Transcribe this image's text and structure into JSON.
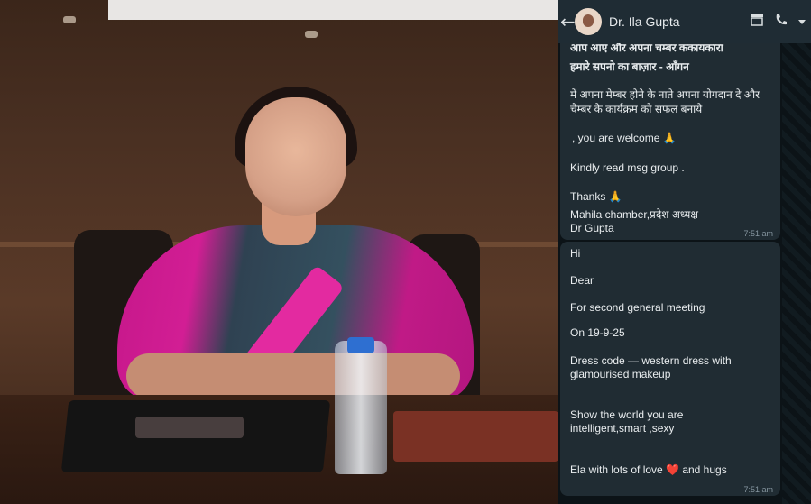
{
  "chat": {
    "contact_name": "Dr. Ila Gupta",
    "back_glyph": "←",
    "icons": [
      "store-icon",
      "call-icon",
      "dropdown-icon"
    ],
    "messages": [
      {
        "lines": [
          "आप आए और अपना चम्बर ककायकारा",
          "हमारे सपनो का बाज़ार - आँगन",
          "में अपना मेम्बर होने के नाते अपना योगदान दे और",
          "चैम्बर के कार्यक्रम को सफल बनाये",
          ", you are welcome 🙏",
          "Kindly read msg group .",
          "Thanks 🙏",
          "Mahila chamber,प्रदेश अध्यक्ष",
          "Dr Gupta"
        ],
        "time": "7:51 am"
      },
      {
        "lines": [
          "Hi",
          "Dear",
          "For second general meeting",
          "On 19-9-25",
          "Dress code — western dress with",
          "glamourised makeup",
          "Show the world you are",
          "intelligent,smart ,sexy",
          "Ela with lots of love ❤️ and hugs"
        ],
        "time": "7:51 am"
      }
    ]
  }
}
